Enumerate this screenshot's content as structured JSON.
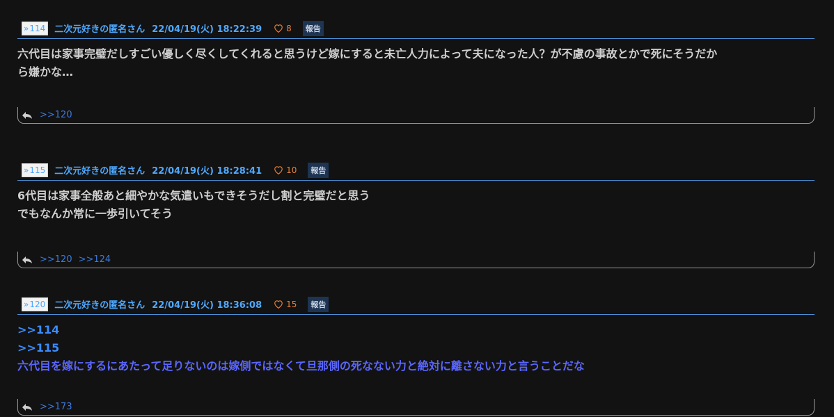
{
  "posts": [
    {
      "number": "114",
      "name": "二次元好きの匿名さん",
      "date": "22/04/19(火) 18:22:39",
      "likes": "8",
      "report": "報告",
      "body_lines": [
        "六代目は家事完璧だしすごい優しく尽くしてくれると思うけど嫁にすると未亡人力によって夫になった人？が不慮の事故とかで死にそうだか",
        "ら嫌かな…"
      ],
      "replies": [
        ">>120"
      ]
    },
    {
      "number": "115",
      "name": "二次元好きの匿名さん",
      "date": "22/04/19(火) 18:28:41",
      "likes": "10",
      "report": "報告",
      "body_lines": [
        "6代目は家事全般あと細やかな気遣いもできそうだし割と完璧だと思う",
        "でもなんか常に一歩引いてそう"
      ],
      "replies": [
        ">>120",
        ">>124"
      ]
    },
    {
      "number": "120",
      "name": "二次元好きの匿名さん",
      "date": "22/04/19(火) 18:36:08",
      "likes": "15",
      "report": "報告",
      "anchors": [
        ">>114",
        ">>115"
      ],
      "body_lines": [
        "六代目を嫁にするにあたって足りないのは嫁側ではなくて旦那側の死なない力と絶対に離さない力と言うことだな"
      ],
      "replies": [
        ">>173"
      ]
    }
  ],
  "colors": {
    "background": "#121212",
    "meta_blue": "#4fa9ff",
    "like_orange": "#e8813a",
    "body_text": "#cfcfcf",
    "anchor_blue": "#3b8cff",
    "purple_text": "#5b66ff"
  }
}
